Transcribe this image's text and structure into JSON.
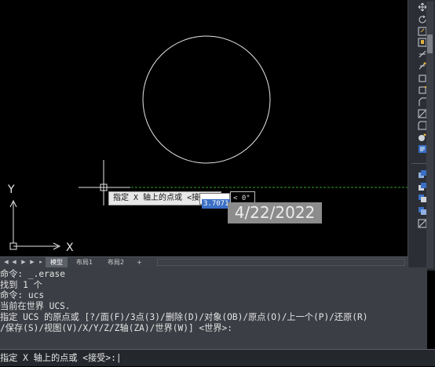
{
  "prompt": {
    "label": "指定 X 轴上的点或 <接受>:",
    "input_value": "3.7071",
    "angle": "< 0°"
  },
  "date_stamp": "4/22/2022",
  "ucs": {
    "x_label": "X",
    "y_label": "Y"
  },
  "tabs": {
    "model": "模型",
    "layout1": "布局1",
    "layout2": "布局2",
    "add": "+"
  },
  "history": [
    "命令: _.erase",
    "找到 1 个",
    "命令: ucs",
    "当前在世界 UCS.",
    "指定 UCS 的原点或 [?/面(F)/3点(3)/删除(D)/对象(OB)/原点(O)/上一个(P)/还原(R)",
    "/保存(S)/视图(V)/X/Y/Z/Z轴(ZA)/世界(W)] <世界>:"
  ],
  "command_line": "指定 X 轴上的点或 <接受>:|",
  "colors": {
    "canvas": "#000000",
    "circle": "#ffffff",
    "guide_line": "#2fa02f",
    "history_bg": "#3b3e44"
  }
}
